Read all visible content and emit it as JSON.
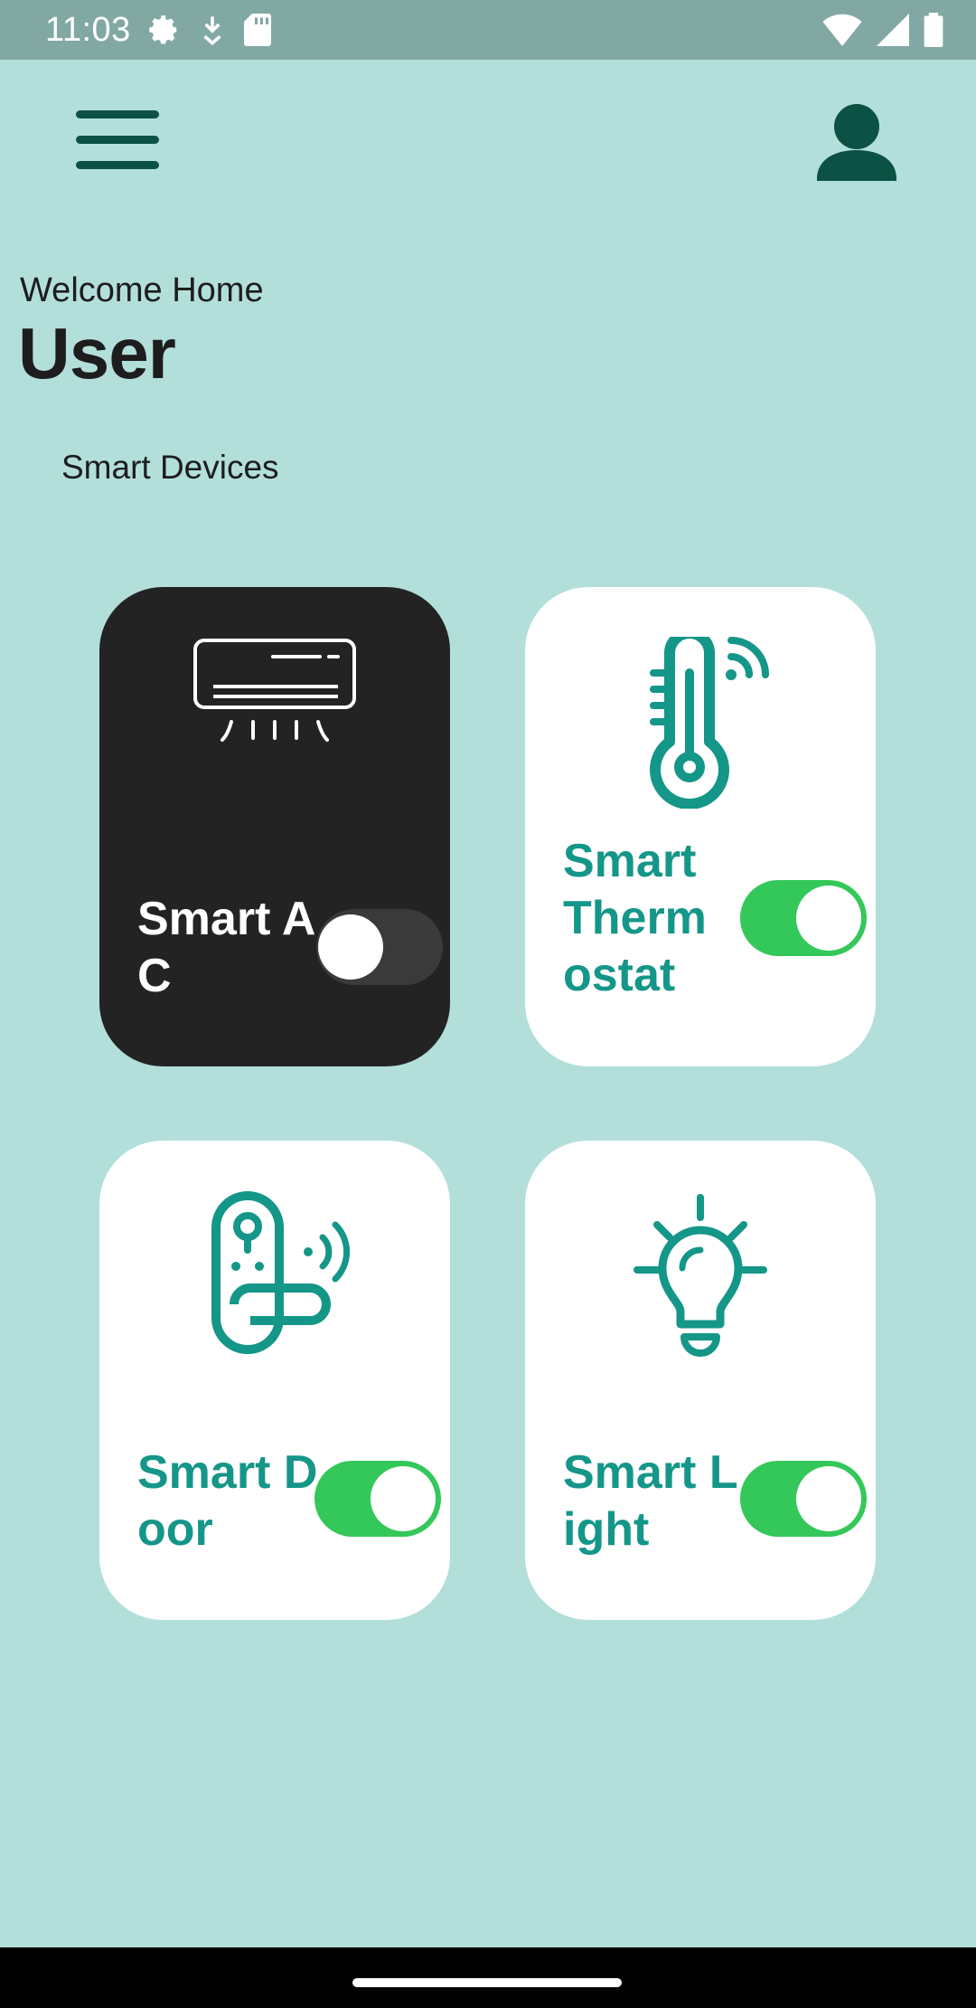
{
  "status_bar": {
    "time": "11:03",
    "left_icons": [
      "settings-icon",
      "download-icon",
      "sd-card-icon"
    ],
    "right_icons": [
      "wifi-icon",
      "signal-icon",
      "battery-icon"
    ]
  },
  "header": {
    "menu_icon": "hamburger-menu-icon",
    "profile_icon": "person-icon",
    "welcome": "Welcome Home",
    "user": "User"
  },
  "section_title": "Smart Devices",
  "devices": [
    {
      "label": "Smart AC",
      "icon": "air-conditioner-icon",
      "on": false,
      "theme": "dark"
    },
    {
      "label": "Smart Thermostat",
      "icon": "thermometer-icon",
      "on": true,
      "theme": "light"
    },
    {
      "label": "Smart Door",
      "icon": "smart-lock-icon",
      "on": true,
      "theme": "light"
    },
    {
      "label": "Smart Light",
      "icon": "light-bulb-icon",
      "on": true,
      "theme": "light"
    }
  ],
  "colors": {
    "background": "#b3dfdb",
    "status_bar": "#82a8a3",
    "accent": "#149688",
    "dark_accent": "#0c5244",
    "toggle_on": "#34c759",
    "toggle_off": "#3a3a3a",
    "card_dark": "#232323",
    "card_light": "#ffffff"
  }
}
